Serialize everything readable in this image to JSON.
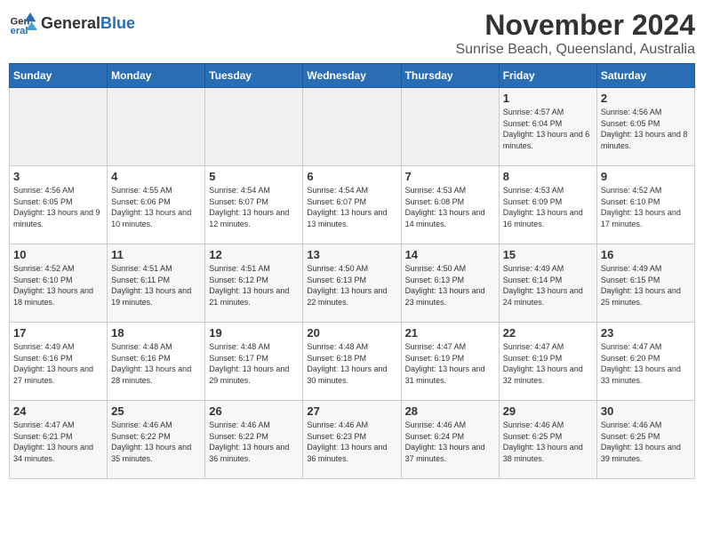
{
  "header": {
    "logo_general": "General",
    "logo_blue": "Blue",
    "month_title": "November 2024",
    "subtitle": "Sunrise Beach, Queensland, Australia"
  },
  "days_of_week": [
    "Sunday",
    "Monday",
    "Tuesday",
    "Wednesday",
    "Thursday",
    "Friday",
    "Saturday"
  ],
  "weeks": [
    [
      {
        "day": "",
        "info": ""
      },
      {
        "day": "",
        "info": ""
      },
      {
        "day": "",
        "info": ""
      },
      {
        "day": "",
        "info": ""
      },
      {
        "day": "",
        "info": ""
      },
      {
        "day": "1",
        "info": "Sunrise: 4:57 AM\nSunset: 6:04 PM\nDaylight: 13 hours and 6 minutes."
      },
      {
        "day": "2",
        "info": "Sunrise: 4:56 AM\nSunset: 6:05 PM\nDaylight: 13 hours and 8 minutes."
      }
    ],
    [
      {
        "day": "3",
        "info": "Sunrise: 4:56 AM\nSunset: 6:05 PM\nDaylight: 13 hours and 9 minutes."
      },
      {
        "day": "4",
        "info": "Sunrise: 4:55 AM\nSunset: 6:06 PM\nDaylight: 13 hours and 10 minutes."
      },
      {
        "day": "5",
        "info": "Sunrise: 4:54 AM\nSunset: 6:07 PM\nDaylight: 13 hours and 12 minutes."
      },
      {
        "day": "6",
        "info": "Sunrise: 4:54 AM\nSunset: 6:07 PM\nDaylight: 13 hours and 13 minutes."
      },
      {
        "day": "7",
        "info": "Sunrise: 4:53 AM\nSunset: 6:08 PM\nDaylight: 13 hours and 14 minutes."
      },
      {
        "day": "8",
        "info": "Sunrise: 4:53 AM\nSunset: 6:09 PM\nDaylight: 13 hours and 16 minutes."
      },
      {
        "day": "9",
        "info": "Sunrise: 4:52 AM\nSunset: 6:10 PM\nDaylight: 13 hours and 17 minutes."
      }
    ],
    [
      {
        "day": "10",
        "info": "Sunrise: 4:52 AM\nSunset: 6:10 PM\nDaylight: 13 hours and 18 minutes."
      },
      {
        "day": "11",
        "info": "Sunrise: 4:51 AM\nSunset: 6:11 PM\nDaylight: 13 hours and 19 minutes."
      },
      {
        "day": "12",
        "info": "Sunrise: 4:51 AM\nSunset: 6:12 PM\nDaylight: 13 hours and 21 minutes."
      },
      {
        "day": "13",
        "info": "Sunrise: 4:50 AM\nSunset: 6:13 PM\nDaylight: 13 hours and 22 minutes."
      },
      {
        "day": "14",
        "info": "Sunrise: 4:50 AM\nSunset: 6:13 PM\nDaylight: 13 hours and 23 minutes."
      },
      {
        "day": "15",
        "info": "Sunrise: 4:49 AM\nSunset: 6:14 PM\nDaylight: 13 hours and 24 minutes."
      },
      {
        "day": "16",
        "info": "Sunrise: 4:49 AM\nSunset: 6:15 PM\nDaylight: 13 hours and 25 minutes."
      }
    ],
    [
      {
        "day": "17",
        "info": "Sunrise: 4:49 AM\nSunset: 6:16 PM\nDaylight: 13 hours and 27 minutes."
      },
      {
        "day": "18",
        "info": "Sunrise: 4:48 AM\nSunset: 6:16 PM\nDaylight: 13 hours and 28 minutes."
      },
      {
        "day": "19",
        "info": "Sunrise: 4:48 AM\nSunset: 6:17 PM\nDaylight: 13 hours and 29 minutes."
      },
      {
        "day": "20",
        "info": "Sunrise: 4:48 AM\nSunset: 6:18 PM\nDaylight: 13 hours and 30 minutes."
      },
      {
        "day": "21",
        "info": "Sunrise: 4:47 AM\nSunset: 6:19 PM\nDaylight: 13 hours and 31 minutes."
      },
      {
        "day": "22",
        "info": "Sunrise: 4:47 AM\nSunset: 6:19 PM\nDaylight: 13 hours and 32 minutes."
      },
      {
        "day": "23",
        "info": "Sunrise: 4:47 AM\nSunset: 6:20 PM\nDaylight: 13 hours and 33 minutes."
      }
    ],
    [
      {
        "day": "24",
        "info": "Sunrise: 4:47 AM\nSunset: 6:21 PM\nDaylight: 13 hours and 34 minutes."
      },
      {
        "day": "25",
        "info": "Sunrise: 4:46 AM\nSunset: 6:22 PM\nDaylight: 13 hours and 35 minutes."
      },
      {
        "day": "26",
        "info": "Sunrise: 4:46 AM\nSunset: 6:22 PM\nDaylight: 13 hours and 36 minutes."
      },
      {
        "day": "27",
        "info": "Sunrise: 4:46 AM\nSunset: 6:23 PM\nDaylight: 13 hours and 36 minutes."
      },
      {
        "day": "28",
        "info": "Sunrise: 4:46 AM\nSunset: 6:24 PM\nDaylight: 13 hours and 37 minutes."
      },
      {
        "day": "29",
        "info": "Sunrise: 4:46 AM\nSunset: 6:25 PM\nDaylight: 13 hours and 38 minutes."
      },
      {
        "day": "30",
        "info": "Sunrise: 4:46 AM\nSunset: 6:25 PM\nDaylight: 13 hours and 39 minutes."
      }
    ]
  ]
}
